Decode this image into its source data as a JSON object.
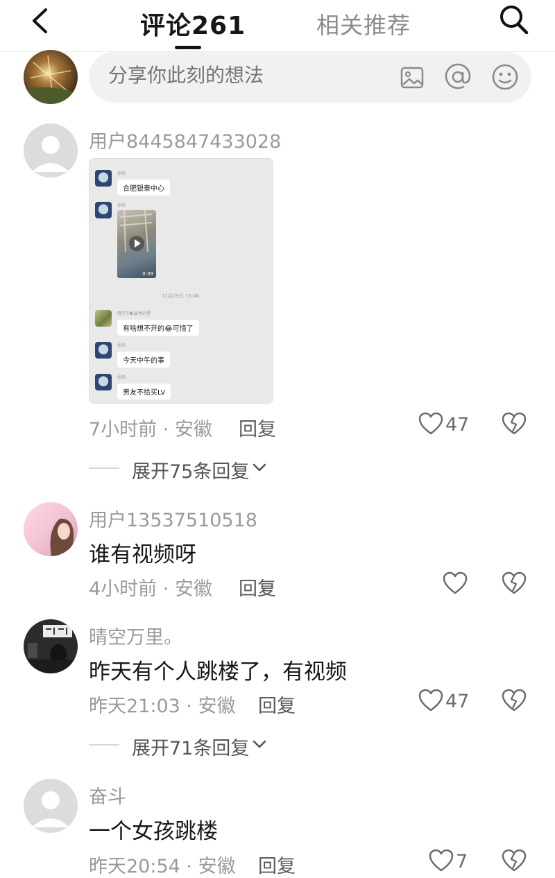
{
  "header": {
    "active_tab": "评论261",
    "inactive_tab": "相关推荐"
  },
  "composer": {
    "placeholder": "分享你此刻的想法"
  },
  "comments": [
    {
      "username": "用户8445847433028",
      "chat_image": {
        "messages": [
          {
            "name": "张伟",
            "text": "合肥银泰中心"
          },
          {
            "name": "张伟",
            "video_duration": "0:39"
          },
          {
            "name": "晴空中🌓最亮的星",
            "text": "有啥想不开的😂可惜了"
          },
          {
            "name": "张伟",
            "text": "今天中午的事"
          },
          {
            "name": "张伟",
            "text": "男友不给买LV"
          }
        ],
        "timestamp": "11月29日 15:46"
      },
      "time": "7小时前",
      "location": "安徽",
      "reply_label": "回复",
      "likes": "47",
      "expand_label": "展开75条回复"
    },
    {
      "username": "用户13537510518",
      "text": "谁有视频呀",
      "time": "4小时前",
      "location": "安徽",
      "reply_label": "回复",
      "likes": ""
    },
    {
      "username": "晴空万里。",
      "text": "昨天有个人跳楼了，有视频",
      "time": "昨天21:03",
      "location": "安徽",
      "reply_label": "回复",
      "likes": "47",
      "expand_label": "展开71条回复"
    },
    {
      "username": "奋斗",
      "text": "一个女孩跳楼",
      "time": "昨天20:54",
      "location": "安徽",
      "reply_label": "回复",
      "likes": "7"
    }
  ],
  "meta_separator": "·",
  "colors": {
    "text_primary": "#161616",
    "text_secondary": "#9a9a9a",
    "composer_bg": "#f1f1f1"
  }
}
